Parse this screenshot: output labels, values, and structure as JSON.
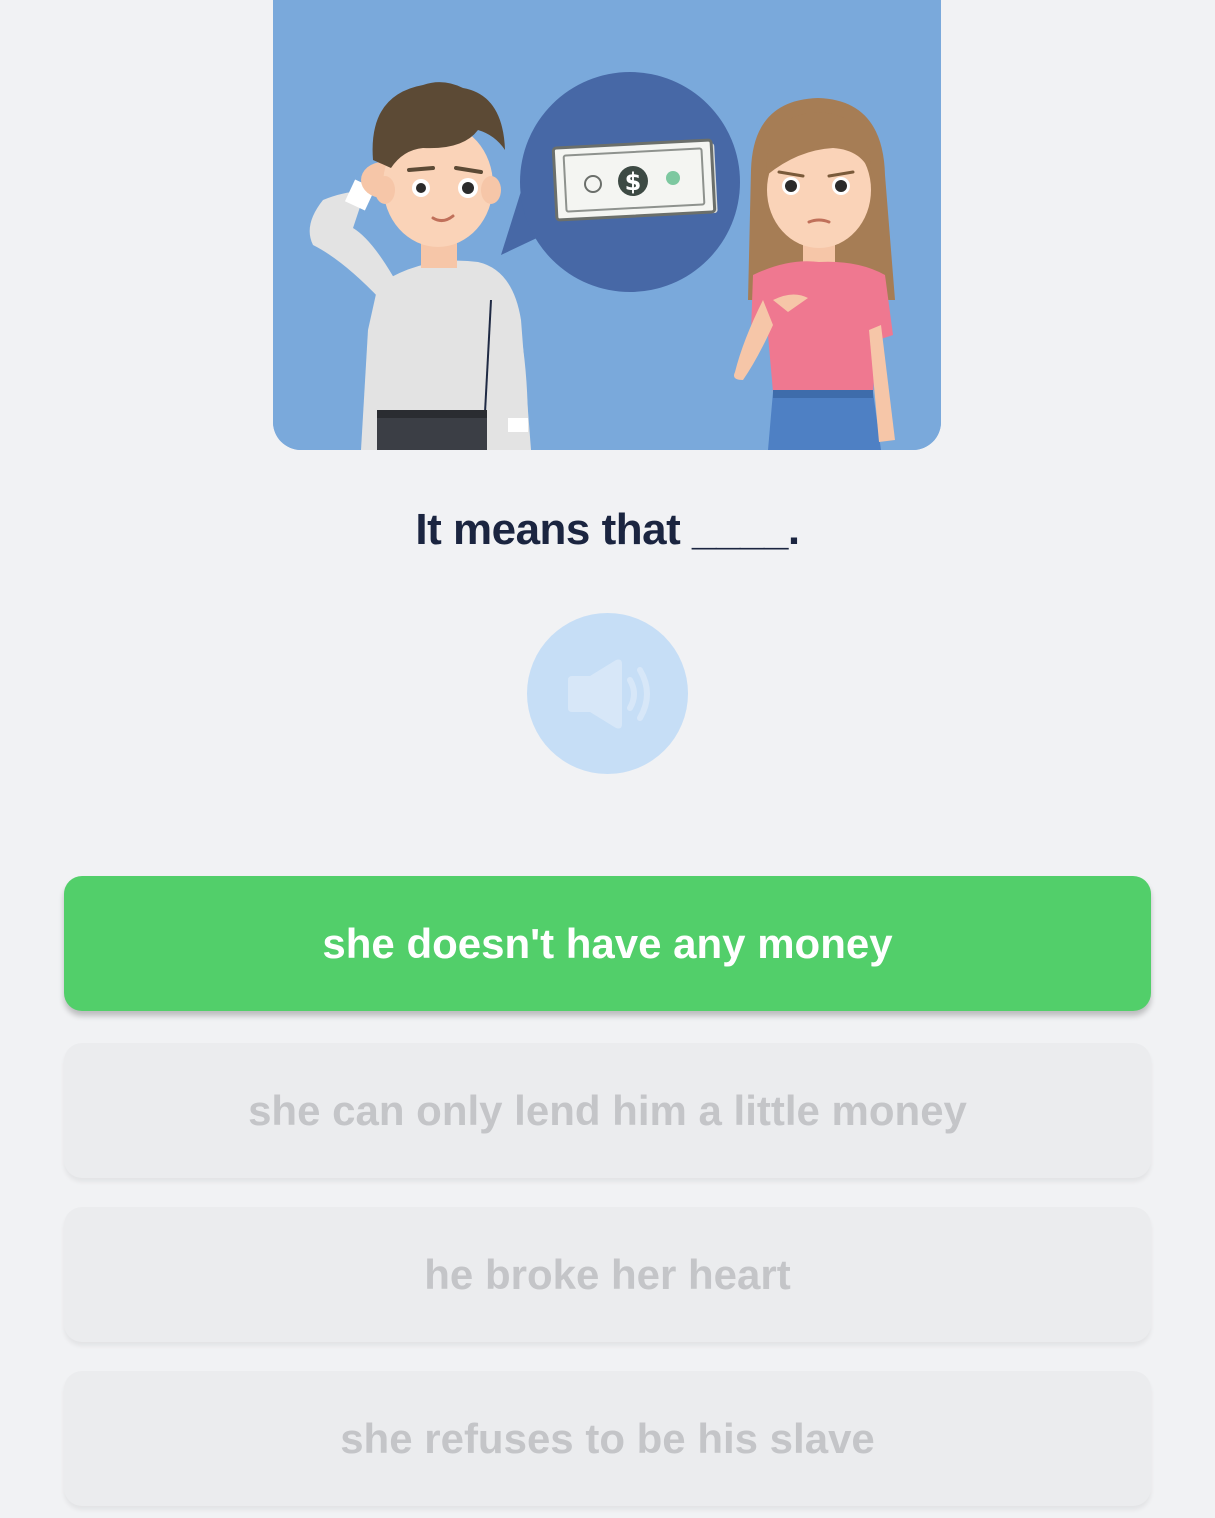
{
  "question": {
    "prompt": "It means that ____."
  },
  "audio": {
    "icon": "speaker-icon"
  },
  "illustration": {
    "icon": "man-woman-money-illustration",
    "bubble_icon": "dollar-bill-icon"
  },
  "options": [
    {
      "label": "she doesn't have any money",
      "state": "correct"
    },
    {
      "label": "she can only lend him a little money",
      "state": "dimmed"
    },
    {
      "label": "he broke her heart",
      "state": "dimmed"
    },
    {
      "label": "she refuses to be his slave",
      "state": "dimmed"
    }
  ],
  "colors": {
    "background": "#f1f2f4",
    "correct": "#52cf6a",
    "dimmed": "#ebecee",
    "audio": "#c6def6",
    "illustration_bg": "#7aa9db"
  }
}
